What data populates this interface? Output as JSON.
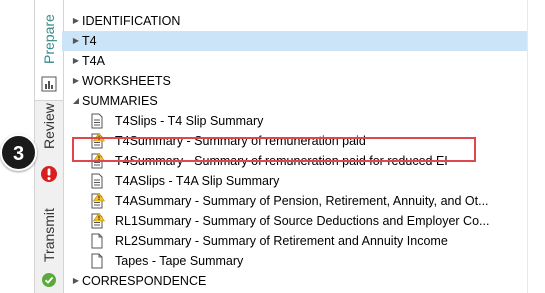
{
  "tabs": {
    "prepare": "Prepare",
    "review": "Review",
    "transmit": "Transmit"
  },
  "callout": {
    "number": "3"
  },
  "tree": {
    "categories": {
      "identification": "IDENTIFICATION",
      "t4": "T4",
      "t4a": "T4A",
      "worksheets": "WORKSHEETS",
      "summaries": "SUMMARIES",
      "correspondence": "CORRESPONDENCE"
    },
    "summaries_items": [
      {
        "label": "T4Slips - T4 Slip Summary",
        "warning": false
      },
      {
        "label": "T4Summary - Summary of remuneration paid",
        "warning": true
      },
      {
        "label": "T4Summary - Summary of remuneration paid for reduced EI",
        "warning": true
      },
      {
        "label": "T4ASlips - T4A Slip Summary",
        "warning": false
      },
      {
        "label": "T4ASummary - Summary of Pension, Retirement, Annuity, and Ot...",
        "warning": true
      },
      {
        "label": "RL1Summary - Summary of Source Deductions and Employer Co...",
        "warning": true
      },
      {
        "label": "RL2Summary - Summary of Retirement and Annuity Income",
        "warning": false
      },
      {
        "label": "Tapes - Tape Summary",
        "warning": false
      }
    ]
  },
  "colors": {
    "selected_row": "#cce4f7",
    "highlight_border": "#e0474a",
    "warning": "#f2c12e",
    "prepare_tab_text": "#3a8a8a"
  }
}
